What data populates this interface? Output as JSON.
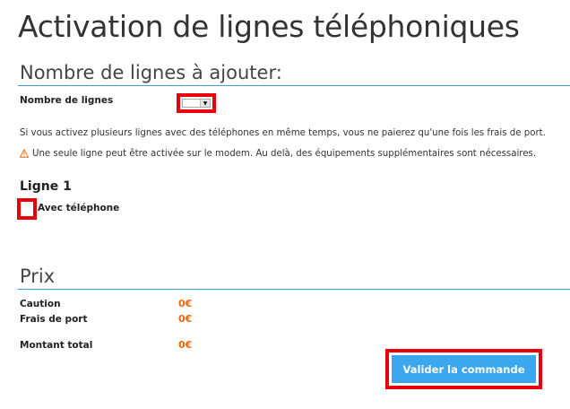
{
  "page": {
    "title": "Activation de lignes téléphoniques"
  },
  "lines_section": {
    "title": "Nombre de lignes à ajouter:",
    "count_label": "Nombre de lignes",
    "count_value": "",
    "info_text": "Si vous activez plusieurs lignes avec des téléphones en même temps, vous ne paierez qu'une fois les frais de port.",
    "warning_text": "Une seule ligne peut être activée sur le modem. Au delà, des équipements supplémentaires sont nécessaires.",
    "warning_icon": "warning-triangle-icon",
    "line_heading": "Ligne 1",
    "with_phone_label": "Avec téléphone",
    "with_phone_checked": false
  },
  "price_section": {
    "title": "Prix",
    "rows": [
      {
        "label": "Caution",
        "value": "0€"
      },
      {
        "label": "Frais de port",
        "value": "0€"
      },
      {
        "label": "Montant total",
        "value": "0€"
      }
    ]
  },
  "actions": {
    "submit_label": "Valider la commande"
  },
  "colors": {
    "accent": "#3aa7ef",
    "rule": "#3aa0d8",
    "price": "#e06a12",
    "highlight": "#e8000b",
    "warning": "#e06a12"
  }
}
